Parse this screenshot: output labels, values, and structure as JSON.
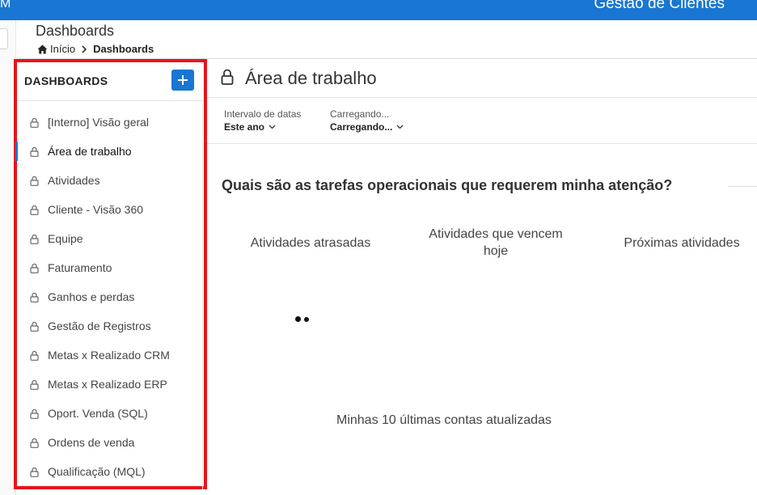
{
  "topbar": {
    "left_fragment": "M",
    "app_title": "Gestão de Clientes"
  },
  "page": {
    "title": "Dashboards",
    "breadcrumb": {
      "home": "Início",
      "current": "Dashboards"
    }
  },
  "sidebar": {
    "title": "DASHBOARDS",
    "add_icon": "plus-icon",
    "items": [
      {
        "label": "[Interno] Visão geral"
      },
      {
        "label": "Área de trabalho",
        "active": true
      },
      {
        "label": "Atividades"
      },
      {
        "label": "Cliente - Visão 360"
      },
      {
        "label": "Equipe"
      },
      {
        "label": "Faturamento"
      },
      {
        "label": "Ganhos e perdas"
      },
      {
        "label": "Gestão de Registros"
      },
      {
        "label": "Metas x Realizado CRM"
      },
      {
        "label": "Metas x Realizado ERP"
      },
      {
        "label": "Oport. Venda (SQL)"
      },
      {
        "label": "Ordens de venda"
      },
      {
        "label": "Qualificação (MQL)"
      }
    ]
  },
  "main": {
    "title": "Área de trabalho",
    "filters": [
      {
        "label": "Intervalo de datas",
        "value": "Este ano"
      },
      {
        "label": "Carregando...",
        "value": "Carregando..."
      }
    ],
    "section_question": "Quais são as tarefas operacionais que requerem minha atenção?",
    "columns": [
      "Atividades atrasadas",
      "Atividades que vencem hoje",
      "Próximas atividades"
    ],
    "last_accounts": "Minhas 10 últimas contas atualizadas"
  },
  "colors": {
    "brand_blue": "#1976d2",
    "highlight_red": "#e8141b"
  }
}
